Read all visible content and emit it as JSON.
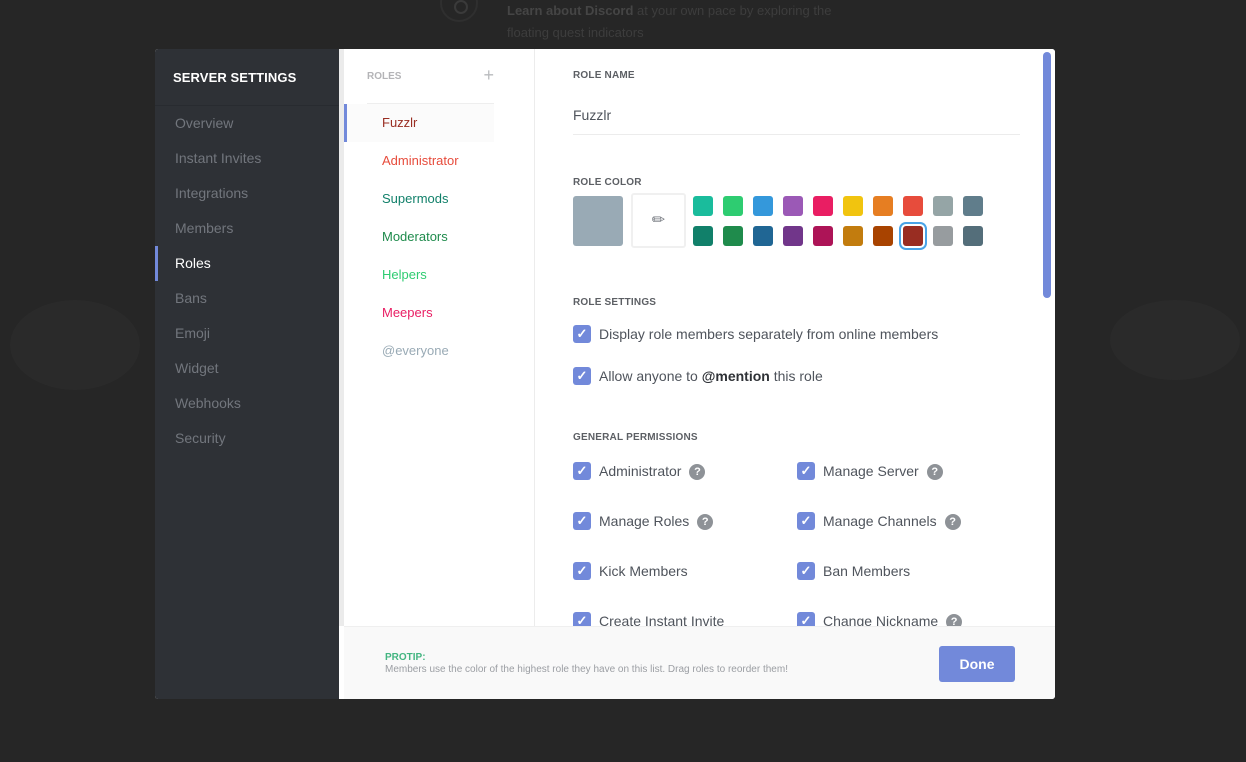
{
  "background": {
    "quest_bold": "Learn about Discord",
    "quest_rest": " at your own pace by exploring the floating quest indicators"
  },
  "sidebar": {
    "title": "SERVER SETTINGS",
    "items": [
      "Overview",
      "Instant Invites",
      "Integrations",
      "Members",
      "Roles",
      "Bans",
      "Emoji",
      "Widget",
      "Webhooks",
      "Security"
    ],
    "active": "Roles"
  },
  "roles_panel": {
    "label": "ROLES",
    "add_icon": "plus-icon",
    "roles": [
      {
        "name": "Fuzzlr",
        "color": "#992d22",
        "selected": true
      },
      {
        "name": "Administrator",
        "color": "#e74c3c"
      },
      {
        "name": "Supermods",
        "color": "#11806a"
      },
      {
        "name": "Moderators",
        "color": "#1f8b4c"
      },
      {
        "name": "Helpers",
        "color": "#2ecc71"
      },
      {
        "name": "Meepers",
        "color": "#e91e63"
      },
      {
        "name": "@everyone",
        "color": "#99aab5"
      }
    ]
  },
  "role_editor": {
    "role_name_label": "ROLE NAME",
    "role_name_value": "Fuzzlr",
    "role_color_label": "ROLE COLOR",
    "default_color": "#99aab5",
    "picker_icon": "eyedropper-icon",
    "swatches_row1": [
      "#1abc9c",
      "#2ecc71",
      "#3498db",
      "#9b59b6",
      "#e91e63",
      "#f1c40f",
      "#e67e22",
      "#e74c3c",
      "#95a5a6",
      "#607d8b"
    ],
    "swatches_row2": [
      "#11806a",
      "#1f8b4c",
      "#206694",
      "#71368a",
      "#ad1457",
      "#c27c0e",
      "#a84300",
      "#992d22",
      "#979c9f",
      "#546e7a"
    ],
    "selected_swatch": "#992d22",
    "role_settings_label": "ROLE SETTINGS",
    "settings": [
      {
        "pre": "Display role members separately from online members",
        "bold": "",
        "post": "",
        "checked": true
      },
      {
        "pre": "Allow anyone to ",
        "bold": "@mention",
        "post": " this role",
        "checked": true
      }
    ],
    "general_permissions_label": "GENERAL PERMISSIONS",
    "permissions": [
      {
        "label": "Administrator",
        "help": true,
        "checked": true
      },
      {
        "label": "Manage Server",
        "help": true,
        "checked": true
      },
      {
        "label": "Manage Roles",
        "help": true,
        "checked": true
      },
      {
        "label": "Manage Channels",
        "help": true,
        "checked": true
      },
      {
        "label": "Kick Members",
        "help": false,
        "checked": true
      },
      {
        "label": "Ban Members",
        "help": false,
        "checked": true
      },
      {
        "label": "Create Instant Invite",
        "help": false,
        "checked": true
      },
      {
        "label": "Change Nickname",
        "help": true,
        "checked": true
      }
    ]
  },
  "footer": {
    "protip_label": "PROTIP:",
    "protip_text": "Members use the color of the highest role they have on this list. Drag roles to reorder them!",
    "done_label": "Done"
  },
  "colors": {
    "accent": "#7289da",
    "sidebar_bg": "#2e3136",
    "protip": "#43b581"
  }
}
